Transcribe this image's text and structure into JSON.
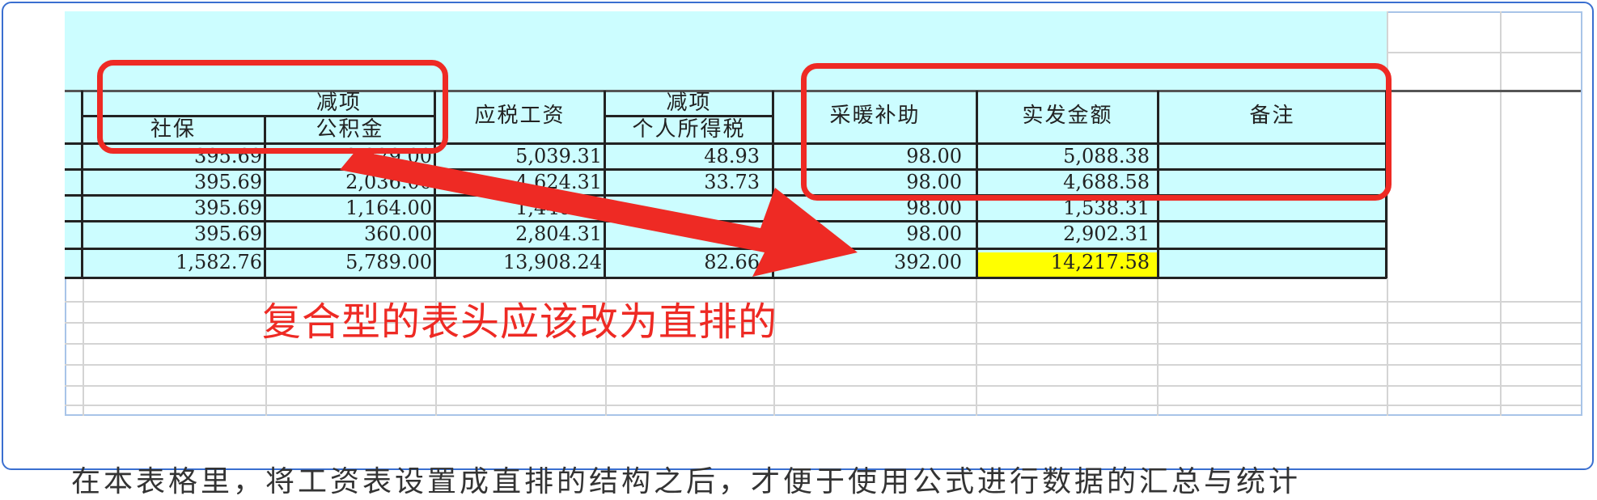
{
  "headers": {
    "group1": "减项",
    "col_shebao": "社保",
    "col_gongjijin": "公积金",
    "col_yingshui": "应税工资",
    "group2": "减项",
    "col_geshui": "个人所得税",
    "col_cainuan": "采暖补助",
    "col_shifa": "实发金额",
    "col_beizhu": "备注"
  },
  "rows": [
    {
      "shebao": "395.69",
      "gongjijin": "2,229.00",
      "yingshui": "5,039.31",
      "geshui": "48.93",
      "cainuan": "98.00",
      "shifa": "5,088.38"
    },
    {
      "shebao": "395.69",
      "gongjijin": "2,036.00",
      "yingshui": "4,624.31",
      "geshui": "33.73",
      "cainuan": "98.00",
      "shifa": "4,688.58"
    },
    {
      "shebao": "395.69",
      "gongjijin": "1,164.00",
      "yingshui": "1,440.31",
      "geshui": "",
      "cainuan": "98.00",
      "shifa": "1,538.31"
    },
    {
      "shebao": "395.69",
      "gongjijin": "360.00",
      "yingshui": "2,804.31",
      "geshui": "",
      "cainuan": "98.00",
      "shifa": "2,902.31"
    },
    {
      "shebao": "1,582.76",
      "gongjijin": "5,789.00",
      "yingshui": "13,908.24",
      "geshui": "82.66",
      "cainuan": "392.00",
      "shifa": "14,217.58"
    }
  ],
  "annotation": "复合型的表头应该改为直排的",
  "bottom_text": "在本表格里，将工资表设置成直排的结构之后，才便于使用公式进行数据的汇总与统计",
  "colors": {
    "accent_red": "#ee2a24",
    "cell_cyan": "#ccfdff",
    "highlight_yellow": "#ffff00"
  }
}
